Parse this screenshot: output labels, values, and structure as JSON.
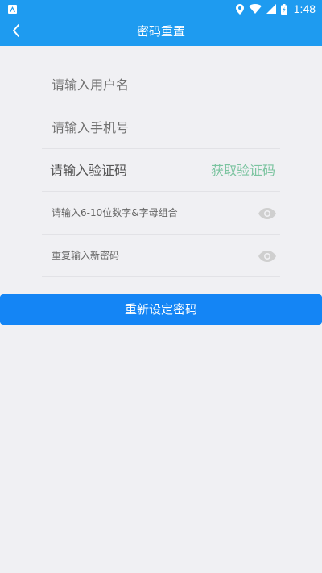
{
  "status_bar": {
    "time": "1:48",
    "notification_icon": "app-notification-icon",
    "icons": [
      "location-icon",
      "wifi-icon",
      "signal-icon",
      "battery-icon"
    ]
  },
  "app_bar": {
    "title": "密码重置",
    "back_icon": "chevron-left-icon"
  },
  "form": {
    "username_placeholder": "请输入用户名",
    "phone_placeholder": "请输入手机号",
    "code_placeholder": "请输入验证码",
    "get_code_label": "获取验证码",
    "password_placeholder": "请输入6-10位数字&字母组合",
    "confirm_password_placeholder": "重复输入新密码"
  },
  "submit_label": "重新设定密码",
  "colors": {
    "primary": "#1e9bf0",
    "button": "#1485f5",
    "get_code_text": "#7cc4a0",
    "background": "#f0f0f3"
  }
}
